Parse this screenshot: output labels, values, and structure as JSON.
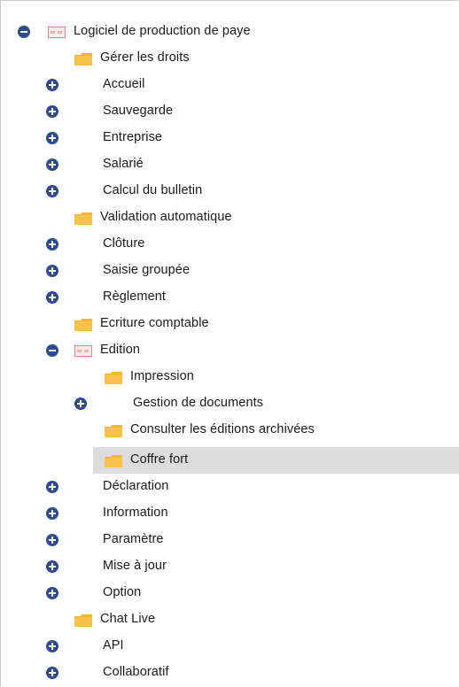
{
  "tree": {
    "root_label": "Logiciel de production de paye",
    "items": [
      {
        "label": "Gérer les droits"
      },
      {
        "label": "Accueil"
      },
      {
        "label": "Sauvegarde"
      },
      {
        "label": "Entreprise"
      },
      {
        "label": "Salarié"
      },
      {
        "label": "Calcul du bulletin"
      },
      {
        "label": "Validation automatique"
      },
      {
        "label": "Clôture"
      },
      {
        "label": "Saisie groupée"
      },
      {
        "label": "Règlement"
      },
      {
        "label": "Ecriture comptable"
      },
      {
        "label": "Edition"
      },
      {
        "label": "Impression"
      },
      {
        "label": "Gestion de documents"
      },
      {
        "label": "Consulter les éditions archivées"
      },
      {
        "label": "Coffre fort"
      },
      {
        "label": "Déclaration"
      },
      {
        "label": "Information"
      },
      {
        "label": "Paramètre"
      },
      {
        "label": "Mise à jour"
      },
      {
        "label": "Option"
      },
      {
        "label": "Chat Live"
      },
      {
        "label": "API"
      },
      {
        "label": "Collaboratif"
      }
    ]
  },
  "colors": {
    "toggle": "#2f4b8a",
    "folder": "#f5b731",
    "module_border": "#d98a8a",
    "selection": "#dcdcdc"
  }
}
